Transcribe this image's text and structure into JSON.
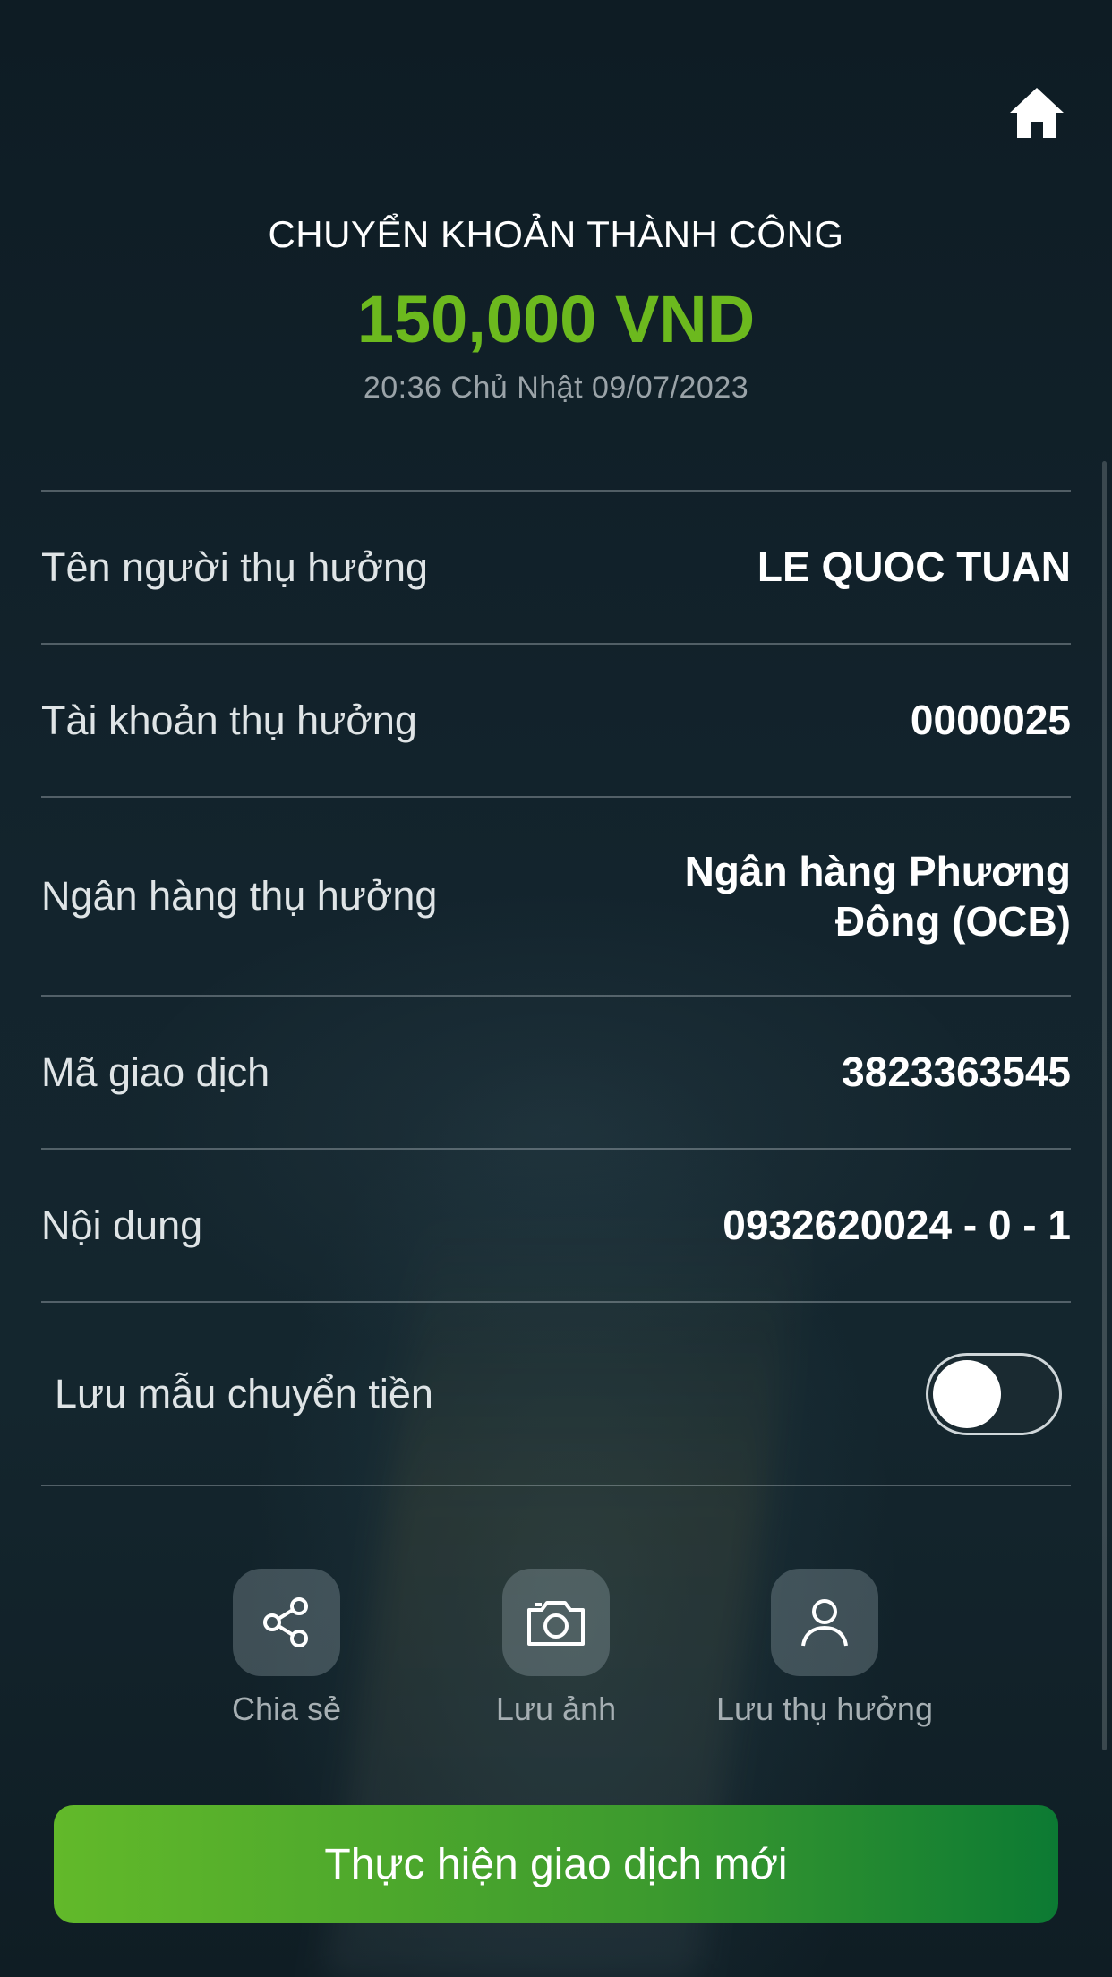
{
  "header": {
    "title": "CHUYỂN KHOẢN THÀNH CÔNG",
    "amount": "150,000 VND",
    "datetime": "20:36 Chủ Nhật 09/07/2023"
  },
  "details": [
    {
      "label": "Tên người thụ hưởng",
      "value": "LE QUOC TUAN"
    },
    {
      "label": "Tài khoản thụ hưởng",
      "value": "0000025"
    },
    {
      "label": "Ngân hàng thụ hưởng",
      "value": "Ngân hàng  Phương Đông (OCB)"
    },
    {
      "label": "Mã giao dịch",
      "value": "3823363545"
    },
    {
      "label": "Nội dung",
      "value": "0932620024 - 0 - 1"
    }
  ],
  "save_template": {
    "label": "Lưu mẫu chuyển tiền",
    "enabled": false
  },
  "actions": [
    {
      "label": "Chia sẻ",
      "icon": "share-icon"
    },
    {
      "label": "Lưu ảnh",
      "icon": "camera-icon"
    },
    {
      "label": "Lưu thụ hưởng",
      "icon": "user-icon"
    }
  ],
  "cta": {
    "label": "Thực hiện giao dịch mới"
  },
  "colors": {
    "accent": "#6cb91e",
    "background": "#0f1e26",
    "cta_start": "#62b92a",
    "cta_end": "#0c7a33"
  }
}
